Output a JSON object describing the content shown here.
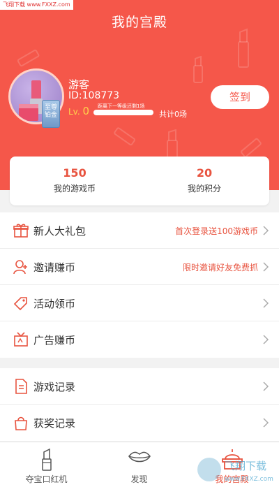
{
  "watermark": {
    "top_text": "飞翔下载 www.FXXZ.com",
    "logo_text": "飞翔下载",
    "logo_url": "www.FXXZ.com"
  },
  "header": {
    "title": "我的宫殿",
    "bg_color": "#f5574a"
  },
  "profile": {
    "username": "游客",
    "user_id": "ID:108773",
    "vip_badge": "至尊铂金",
    "level_prefix": "Lv.",
    "level_value": "0",
    "level_hint": "距离下一等级还剩1场",
    "total_games": "共计0场",
    "level_progress": 0
  },
  "signin": {
    "label": "签到"
  },
  "stats": [
    {
      "value": "150",
      "label": "我的游戏币"
    },
    {
      "value": "20",
      "label": "我的积分"
    }
  ],
  "menu_group_1": [
    {
      "icon": "gift-icon",
      "label": "新人大礼包",
      "right": "首次登录送100游戏币"
    },
    {
      "icon": "user-add-icon",
      "label": "邀请赚币",
      "right": "限时邀请好友免费抓"
    },
    {
      "icon": "tag-icon",
      "label": "活动领币",
      "right": ""
    },
    {
      "icon": "ad-icon",
      "label": "广告赚币",
      "right": ""
    }
  ],
  "menu_group_2": [
    {
      "icon": "document-icon",
      "label": "游戏记录",
      "right": ""
    },
    {
      "icon": "bag-icon",
      "label": "获奖记录",
      "right": ""
    }
  ],
  "tabbar": [
    {
      "icon": "lipstick-icon",
      "label": "夺宝口红机",
      "active": false
    },
    {
      "icon": "lips-icon",
      "label": "发现",
      "active": false
    },
    {
      "icon": "palace-icon",
      "label": "我的宫殿",
      "active": true
    }
  ],
  "colors": {
    "accent": "#e8533f",
    "header": "#f5574a",
    "background": "#f2f2f2"
  }
}
